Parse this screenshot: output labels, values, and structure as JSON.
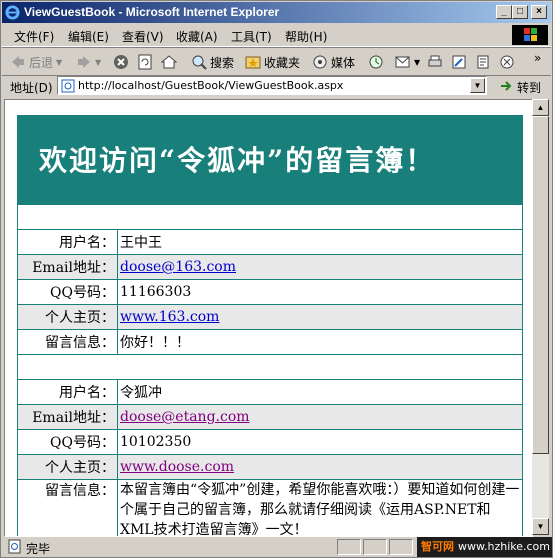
{
  "window": {
    "title": "ViewGuestBook - Microsoft Internet Explorer",
    "buttons": {
      "minimize": "_",
      "maximize": "□",
      "close": "×"
    }
  },
  "menu": [
    "文件(F)",
    "编辑(E)",
    "查看(V)",
    "收藏(A)",
    "工具(T)",
    "帮助(H)"
  ],
  "toolbar": {
    "back": "后退",
    "search": "搜索",
    "favorites": "收藏夹",
    "media": "媒体",
    "overflow": "»"
  },
  "address": {
    "label": "地址(D)",
    "url": "http://localhost/GuestBook/ViewGuestBook.aspx",
    "go": "转到"
  },
  "page": {
    "banner_title": "欢迎访问“令狐冲”的留言簿！",
    "labels": {
      "username": "用户名：",
      "email": "Email地址：",
      "qq": "QQ号码：",
      "homepage": "个人主页：",
      "message": "留言信息："
    },
    "entries": [
      {
        "username": "王中王",
        "email": "doose@163.com",
        "qq": "11166303",
        "homepage": "www.163.com",
        "message": "你好！！！"
      },
      {
        "username": "令狐冲",
        "email": "doose@etang.com",
        "qq": "10102350",
        "homepage": "www.doose.com",
        "message": "本留言簿由“令狐冲”创建，希望你能喜欢哦：）要知道如何创建一个属于自己的留言簿，那么就请仔细阅读《运用ASP.NET和XML技术打造留言簿》一文！"
      }
    ]
  },
  "status": {
    "text": "完毕",
    "watermark_brand": "智可网",
    "watermark_url": "www.hzhike.com"
  },
  "colors": {
    "banner": "#187f7a",
    "table_border": "#187f7a",
    "alt_row": "#e8e8e8",
    "link": "#0000cc",
    "visited_link": "#800080"
  }
}
